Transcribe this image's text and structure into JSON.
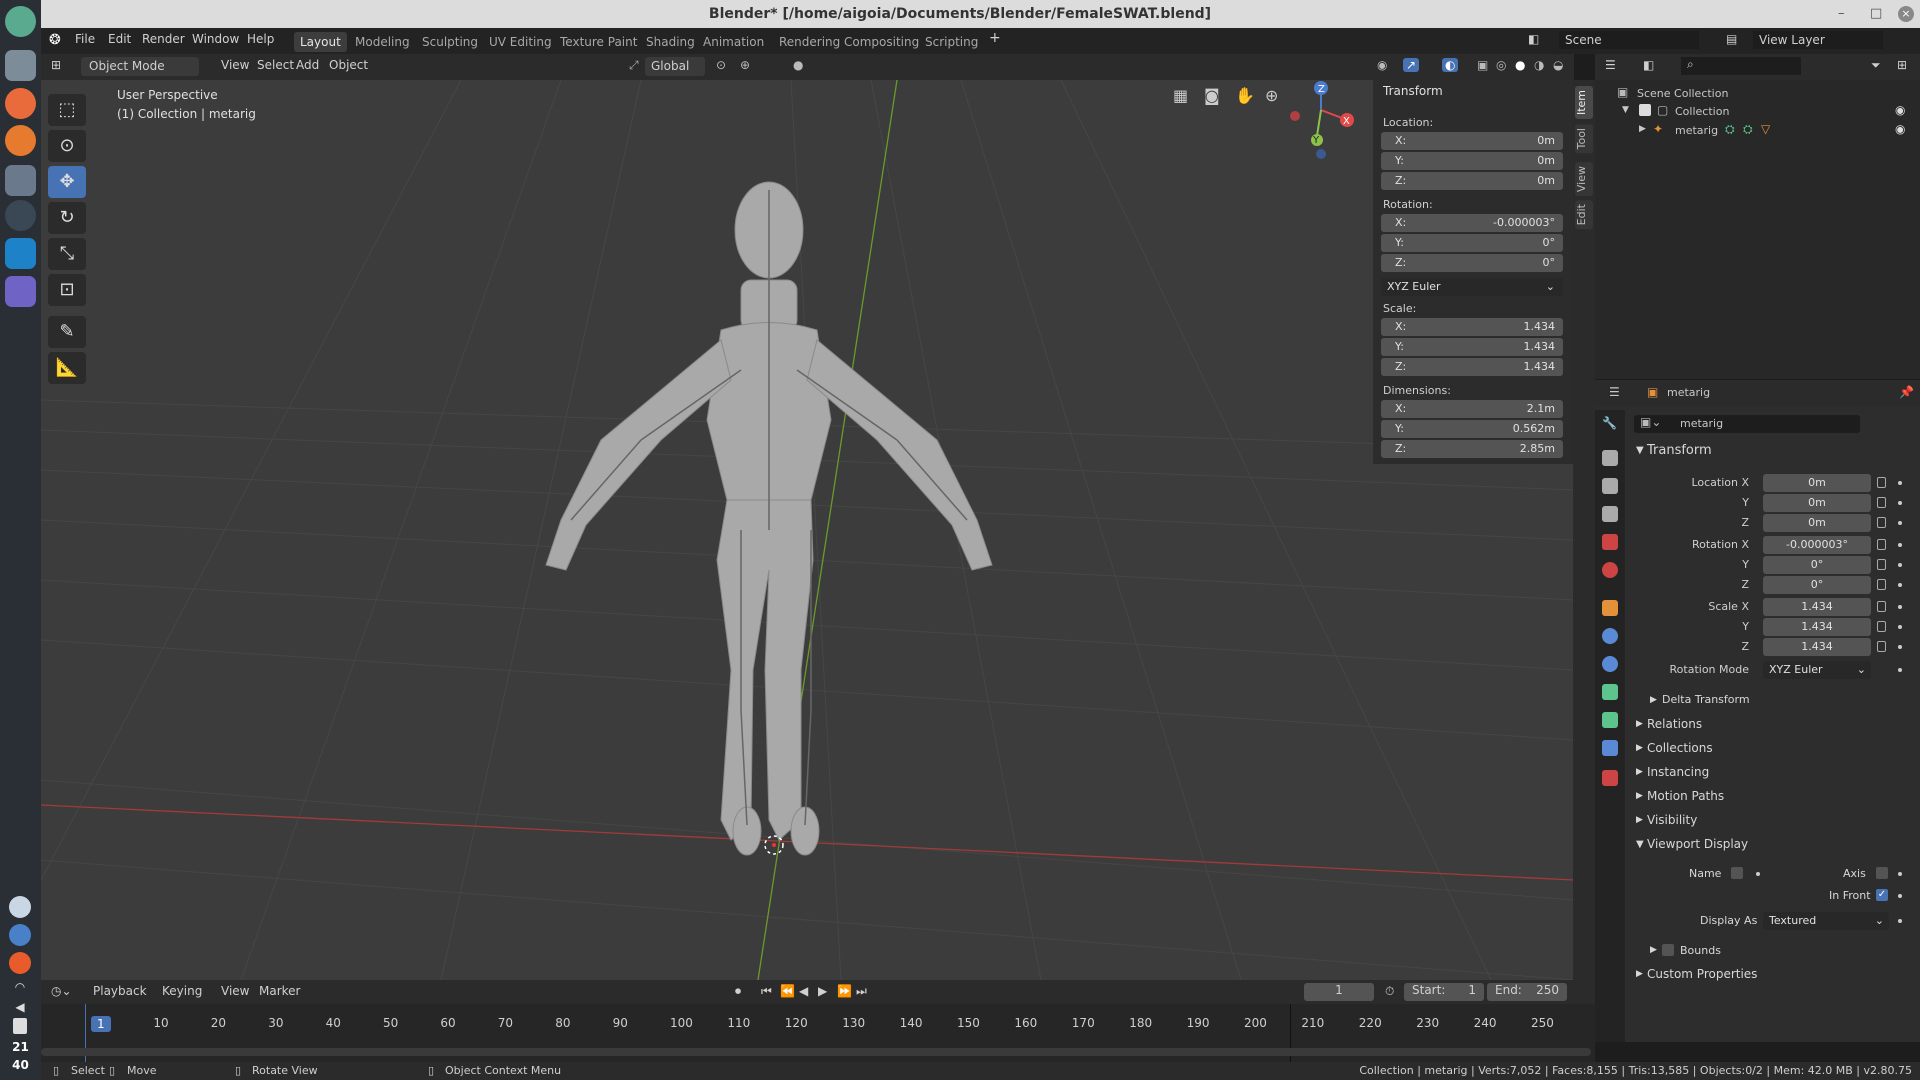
{
  "window": {
    "title": "Blender* [/home/aigoia/Documents/Blender/FemaleSWAT.blend]"
  },
  "dock": {
    "clock_hour": "21",
    "clock_minute": "40"
  },
  "menus": [
    "File",
    "Edit",
    "Render",
    "Window",
    "Help"
  ],
  "workspaces": [
    "Layout",
    "Modeling",
    "Sculpting",
    "UV Editing",
    "Texture Paint",
    "Shading",
    "Animation",
    "Rendering",
    "Compositing",
    "Scripting"
  ],
  "scene_name": "Scene",
  "view_layer": "View Layer",
  "viewport_header": {
    "mode": "Object Mode",
    "menus": [
      "View",
      "Select",
      "Add",
      "Object"
    ],
    "orientation": "Global"
  },
  "viewport": {
    "view_name": "User Perspective",
    "context": "(1) Collection | metarig",
    "gizmo": {
      "x": "X",
      "y": "Y",
      "z": "Z"
    }
  },
  "npanel": {
    "title": "Transform",
    "location_label": "Location:",
    "location": [
      {
        "k": "X:",
        "v": "0m"
      },
      {
        "k": "Y:",
        "v": "0m"
      },
      {
        "k": "Z:",
        "v": "0m"
      }
    ],
    "rotation_label": "Rotation:",
    "rotation": [
      {
        "k": "X:",
        "v": "-0.000003°"
      },
      {
        "k": "Y:",
        "v": "0°"
      },
      {
        "k": "Z:",
        "v": "0°"
      }
    ],
    "rotation_mode": "XYZ Euler",
    "scale_label": "Scale:",
    "scale": [
      {
        "k": "X:",
        "v": "1.434"
      },
      {
        "k": "Y:",
        "v": "1.434"
      },
      {
        "k": "Z:",
        "v": "1.434"
      }
    ],
    "dimensions_label": "Dimensions:",
    "dimensions": [
      {
        "k": "X:",
        "v": "2.1m"
      },
      {
        "k": "Y:",
        "v": "0.562m"
      },
      {
        "k": "Z:",
        "v": "2.85m"
      }
    ]
  },
  "sidetabs": [
    "Item",
    "Tool",
    "View",
    "Edit"
  ],
  "outliner": {
    "scene_collection": "Scene Collection",
    "collection": "Collection",
    "object": "metarig"
  },
  "properties": {
    "object_name": "metarig",
    "datablock": "metarig",
    "transform_title": "Transform",
    "rows": [
      {
        "label": "Location X",
        "value": "0m"
      },
      {
        "label": "Y",
        "value": "0m"
      },
      {
        "label": "Z",
        "value": "0m"
      },
      {
        "label": "Rotation X",
        "value": "-0.000003°"
      },
      {
        "label": "Y",
        "value": "0°"
      },
      {
        "label": "Z",
        "value": "0°"
      },
      {
        "label": "Scale X",
        "value": "1.434"
      },
      {
        "label": "Y",
        "value": "1.434"
      },
      {
        "label": "Z",
        "value": "1.434"
      }
    ],
    "rotation_mode_label": "Rotation Mode",
    "rotation_mode": "XYZ Euler",
    "delta": "Delta Transform",
    "sections": [
      "Relations",
      "Collections",
      "Instancing",
      "Motion Paths",
      "Visibility"
    ],
    "viewport_display": "Viewport Display",
    "vd_name": "Name",
    "vd_axis": "Axis",
    "vd_infront": "In Front",
    "vd_infront_checked": true,
    "vd_displayas_label": "Display As",
    "vd_displayas": "Textured",
    "vd_bounds": "Bounds",
    "custom_props": "Custom Properties"
  },
  "timeline": {
    "menus": [
      "Playback",
      "Keying",
      "View",
      "Marker"
    ],
    "current_frame": "1",
    "start_label": "Start:",
    "start": "1",
    "end_label": "End:",
    "end": "250",
    "ticks": [
      "1",
      "10",
      "20",
      "30",
      "40",
      "50",
      "60",
      "70",
      "80",
      "90",
      "100",
      "110",
      "120",
      "130",
      "140",
      "150",
      "160",
      "170",
      "180",
      "190",
      "200",
      "210",
      "220",
      "230",
      "240",
      "250"
    ]
  },
  "status": {
    "select": "Select",
    "move": "Move",
    "rotate": "Rotate View",
    "context": "Object Context Menu",
    "stats": "Collection | metarig | Verts:7,052 | Faces:8,155 | Tris:13,585 | Objects:0/2 | Mem: 42.0 MB | v2.80.75"
  }
}
